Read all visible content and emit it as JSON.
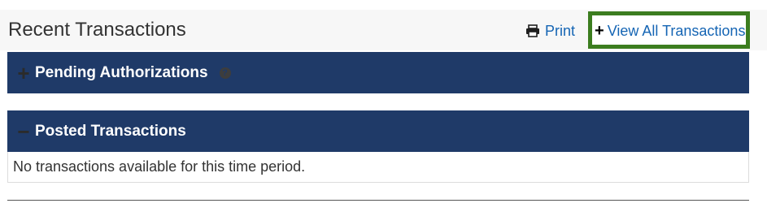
{
  "header": {
    "title": "Recent Transactions",
    "print_label": "Print",
    "print_icon": "printer-icon",
    "view_all_label": "View All Transactions",
    "view_all_icon": "plus-icon",
    "highlight_color": "#3c7d1f"
  },
  "panels": {
    "pending": {
      "title": "Pending Authorizations",
      "toggle": "+",
      "state": "collapsed",
      "info_icon": "info-icon"
    },
    "posted": {
      "title": "Posted Transactions",
      "toggle": "−",
      "state": "expanded",
      "empty_message": "No transactions available for this time period."
    }
  },
  "colors": {
    "panel_header_bg": "#1f3a68",
    "link": "#1565b4"
  }
}
